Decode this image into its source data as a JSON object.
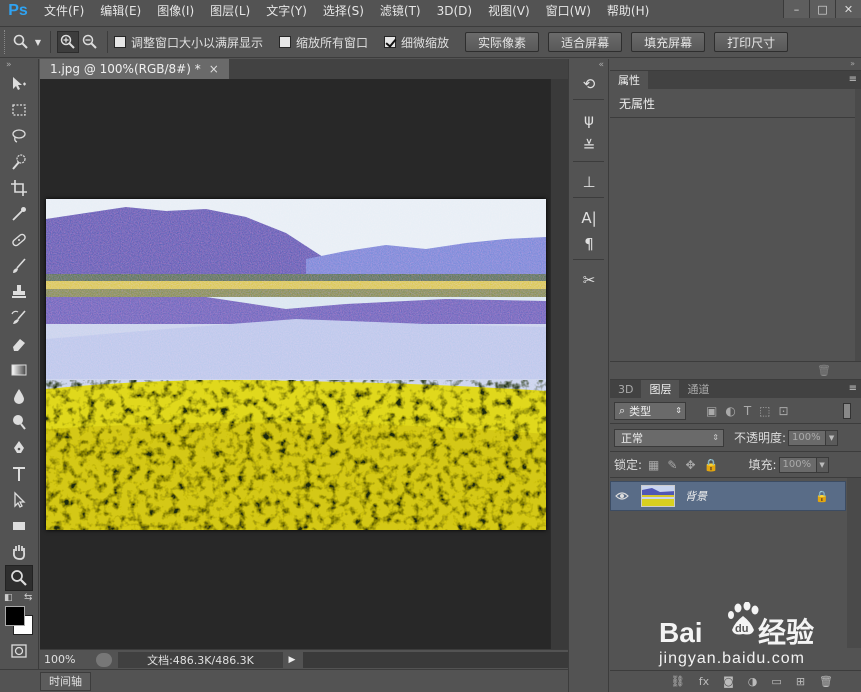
{
  "app": {
    "logo": "Ps"
  },
  "menu": [
    "文件(F)",
    "编辑(E)",
    "图像(I)",
    "图层(L)",
    "文字(Y)",
    "选择(S)",
    "滤镜(T)",
    "3D(D)",
    "视图(V)",
    "窗口(W)",
    "帮助(H)"
  ],
  "options": {
    "checkboxes": [
      {
        "label": "调整窗口大小以满屏显示",
        "checked": false
      },
      {
        "label": "缩放所有窗口",
        "checked": false
      },
      {
        "label": "细微缩放",
        "checked": true
      }
    ],
    "buttons": [
      "实际像素",
      "适合屏幕",
      "填充屏幕",
      "打印尺寸"
    ]
  },
  "document": {
    "tab_title": "1.jpg @ 100%(RGB/8#) *",
    "close": "×"
  },
  "status": {
    "zoom": "100%",
    "doc_info": "文档:486.3K/486.3K"
  },
  "timeline": {
    "label": "时间轴"
  },
  "properties": {
    "tab": "属性",
    "content": "无属性"
  },
  "layers": {
    "tabs": [
      "3D",
      "图层",
      "通道"
    ],
    "active_tab": "图层",
    "kind": "类型",
    "blend_mode": "正常",
    "opacity_label": "不透明度:",
    "opacity": "100%",
    "lock_label": "锁定:",
    "fill_label": "填充:",
    "fill": "100%",
    "items": [
      {
        "name": "背景",
        "locked": true,
        "visible": true
      }
    ]
  },
  "watermark": {
    "text": "jingyan.baidu.com"
  },
  "colors": {
    "accent": "#2fa3f2",
    "selected_layer": "#596c87"
  }
}
